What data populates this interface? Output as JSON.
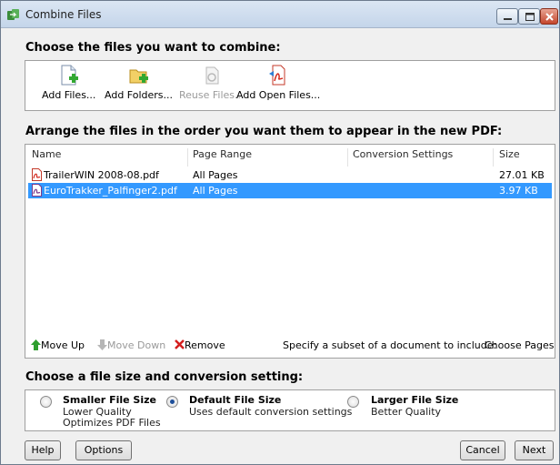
{
  "window": {
    "title": "Combine Files",
    "icon": "combine-files-icon"
  },
  "sections": {
    "choose_files": "Choose the files you want to combine:",
    "arrange_files": "Arrange the files in the order you want them to appear in the new PDF:",
    "file_size": "Choose a file size and conversion setting:"
  },
  "toolbar": {
    "add_files": "Add Files...",
    "add_folders": "Add Folders...",
    "reuse_files": "Reuse Files...",
    "add_open_files": "Add Open Files..."
  },
  "columns": {
    "name": "Name",
    "page_range": "Page Range",
    "conversion_settings": "Conversion Settings",
    "size": "Size"
  },
  "files": [
    {
      "name": "TrailerWIN 2008-08.pdf",
      "page_range": "All Pages",
      "conversion_settings": "",
      "size": "27.01 KB",
      "selected": false
    },
    {
      "name": "EuroTrakker_Palfinger2.pdf",
      "page_range": "All Pages",
      "conversion_settings": "",
      "size": "3.97 KB",
      "selected": true
    }
  ],
  "list_actions": {
    "move_up": "Move Up",
    "move_down": "Move Down",
    "remove": "Remove",
    "subset_prompt": "Specify a subset of a document to include:",
    "choose_pages": "Choose Pages"
  },
  "file_size_options": [
    {
      "title": "Smaller File Size",
      "lines": [
        "Lower Quality",
        "Optimizes PDF Files"
      ],
      "checked": false
    },
    {
      "title": "Default File Size",
      "lines": [
        "Uses default conversion settings"
      ],
      "checked": true
    },
    {
      "title": "Larger File Size",
      "lines": [
        "Better Quality"
      ],
      "checked": false
    }
  ],
  "buttons": {
    "help": "Help",
    "options": "Options",
    "cancel": "Cancel",
    "next": "Next"
  },
  "colors": {
    "selection": "#3399ff",
    "pdf_red": "#d42a1e",
    "move_up_green": "#2e9e2e",
    "remove_red": "#d41e1e"
  }
}
